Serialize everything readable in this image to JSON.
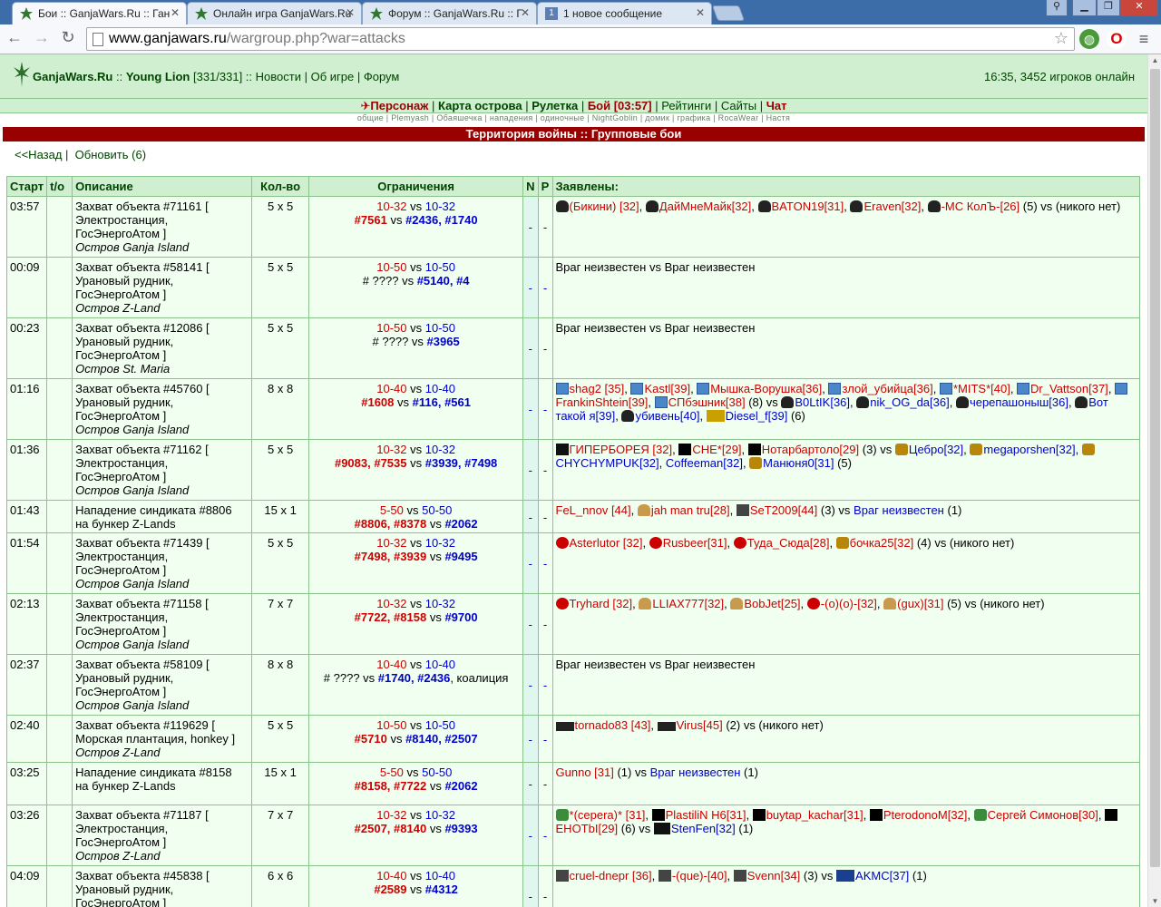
{
  "browser": {
    "tabs": [
      {
        "title": "Бои :: GanjaWars.Ru :: Ган",
        "active": true
      },
      {
        "title": "Онлайн игра GanjaWars.Ru",
        "active": false
      },
      {
        "title": "Форум :: GanjaWars.Ru :: Г",
        "active": false
      },
      {
        "title": "1 новое сообщение",
        "active": false
      }
    ],
    "url_host": "www.ganjawars.ru",
    "url_path": "/wargroup.php?war=attacks"
  },
  "site": {
    "brand": "GanjaWars.Ru",
    "sep1": " :: ",
    "user": "Young Lion",
    "hp": " [331/331] :: ",
    "news": "Новости",
    "about": "Об игре",
    "forum": "Форум",
    "online": "16:35, 3452 игроков онлайн"
  },
  "menu": {
    "person": "Персонаж",
    "map": "Карта острова",
    "roulette": "Рулетка",
    "fight": "Бой [03:57]",
    "ratings": "Рейтинги",
    "sites": "Сайты",
    "chat": "Чат"
  },
  "submenu": "общие | Plemyash | Обаяшечка | нападения | одиночные | NightGoblin | домик | графика | RocaWear | Настя",
  "page_title": "Территория войны :: Групповые бои",
  "nav": {
    "back": "<<Назад",
    "refresh": "Обновить (6)"
  },
  "table": {
    "headers": [
      "Старт",
      "t/o",
      "Описание",
      "Кол-во",
      "Ограничения",
      "N",
      "P",
      "Заявлены:"
    ]
  },
  "rows": [
    {
      "start": "03:57",
      "d1": "Захват объекта #71161 [",
      "d2": "Электростанция,",
      "d3": "ГосЭнергоАтом ]",
      "d4": "Остров Ganja Island",
      "qty": "5 x 5",
      "l1a": "10-32",
      "l1b": "10-32",
      "l2": "#7561",
      "l2b": "#2436, #1740"
    },
    {
      "start": "00:09",
      "d1": "Захват объекта #58141 [",
      "d2": "Урановый рудник,",
      "d3": "ГосЭнергоАтом ]",
      "d4": "Остров Z-Land",
      "qty": "5 x 5",
      "l1a": "10-50",
      "l1b": "10-50",
      "l2": "# ????",
      "l2b": "#5140, #4",
      "plain": "Враг неизвестен vs Враг неизвестен"
    },
    {
      "start": "00:23",
      "d1": "Захват объекта #12086 [",
      "d2": "Урановый рудник,",
      "d3": "ГосЭнергоАтом ]",
      "d4": "Остров St. Maria",
      "qty": "5 x 5",
      "l1a": "10-50",
      "l1b": "10-50",
      "l2": "# ????",
      "l2b": "#3965",
      "plain": "Враг неизвестен vs Враг неизвестен"
    },
    {
      "start": "01:16",
      "d1": "Захват объекта #45760 [",
      "d2": "Урановый рудник,",
      "d3": "ГосЭнергоАтом ]",
      "d4": "Остров Ganja Island",
      "qty": "8 x 8",
      "l1a": "10-40",
      "l1b": "10-40",
      "l2": "#1608",
      "l2b": "#116, #561"
    },
    {
      "start": "01:36",
      "d1": "Захват объекта #71162 [",
      "d2": "Электростанция,",
      "d3": "ГосЭнергоАтом ]",
      "d4": "Остров Ganja Island",
      "qty": "5 x 5",
      "l1a": "10-32",
      "l1b": "10-32",
      "l2": "#9083, #7535",
      "l2b": "#3939, #7498"
    },
    {
      "start": "01:43",
      "d1": "Нападение синдиката #8806",
      "d2": "на бункер Z-Lands",
      "d3": "",
      "d4": "",
      "qty": "15 x 1",
      "l1a": "5-50",
      "l1b": "50-50",
      "l2": "#8806, #8378",
      "l2b": "#2062"
    },
    {
      "start": "01:54",
      "d1": "Захват объекта #71439 [",
      "d2": "Электростанция,",
      "d3": "ГосЭнергоАтом ]",
      "d4": "Остров Ganja Island",
      "qty": "5 x 5",
      "l1a": "10-32",
      "l1b": "10-32",
      "l2": "#7498, #3939",
      "l2b": "#9495"
    },
    {
      "start": "02:13",
      "d1": "Захват объекта #71158 [",
      "d2": "Электростанция,",
      "d3": "ГосЭнергоАтом ]",
      "d4": "Остров Ganja Island",
      "qty": "7 x 7",
      "l1a": "10-32",
      "l1b": "10-32",
      "l2": "#7722, #8158",
      "l2b": "#9700"
    },
    {
      "start": "02:37",
      "d1": "Захват объекта #58109 [",
      "d2": "Урановый рудник,",
      "d3": "ГосЭнергоАтом ]",
      "d4": "Остров Ganja Island",
      "qty": "8 x 8",
      "l1a": "10-40",
      "l1b": "10-40",
      "l2": "# ????",
      "l2b": "#1740, #2436",
      "l2c": ", коалиция",
      "plain": "Враг неизвестен vs Враг неизвестен"
    },
    {
      "start": "02:40",
      "d1": "Захват объекта #119629 [",
      "d2": "Морская плантация, honkey ]",
      "d3": "Остров Z-Land",
      "d4": "",
      "qty": "5 x 5",
      "l1a": "10-50",
      "l1b": "10-50",
      "l2": "#5710",
      "l2b": "#8140, #2507"
    },
    {
      "start": "03:25",
      "d1": "Нападение синдиката #8158",
      "d2": "на бункер Z-Lands",
      "d3": "",
      "d4": "",
      "qty": "15 x 1",
      "l1a": "5-50",
      "l1b": "50-50",
      "l2": "#8158, #7722",
      "l2b": "#2062"
    },
    {
      "start": "03:26",
      "d1": "Захват объекта #71187 [",
      "d2": "Электростанция,",
      "d3": "ГосЭнергоАтом ]",
      "d4": "Остров Z-Land",
      "qty": "7 x 7",
      "l1a": "10-32",
      "l1b": "10-32",
      "l2": "#2507, #8140",
      "l2b": "#9393"
    },
    {
      "start": "04:09",
      "d1": "Захват объекта #45838 [",
      "d2": "Урановый рудник,",
      "d3": "ГосЭнергоАтом ]",
      "d4": "",
      "qty": "6 x 6",
      "l1a": "10-40",
      "l1b": "10-40",
      "l2": "#2589",
      "l2b": "#4312"
    }
  ],
  "np": "-",
  "vs": "vs",
  "declared": {
    "r0": [
      [
        "skull",
        "(Бикини) [32]"
      ],
      [
        "skull",
        "ДайМнеМайк[32]"
      ],
      [
        "skull",
        "BATON19[31]"
      ],
      [
        "skull",
        "Eraven[32]"
      ],
      [
        "skull",
        "-MC КолЪ-[26]"
      ]
    ],
    "r0_tail": "(5) vs (никого нет)",
    "r3a": [
      [
        "cube",
        "shag2 [35]"
      ],
      [
        "cube",
        "Kastl[39]"
      ],
      [
        "cube",
        "Мышка-Ворушка[36]"
      ],
      [
        "cube",
        "злой_убийца[36]"
      ],
      [
        "cube",
        "*MITS*[40]"
      ],
      [
        "cube",
        "Dr_Vattson[37]"
      ],
      [
        "cube",
        "FrankinShtein[39]"
      ],
      [
        "cube",
        "СПбэшник[38]"
      ]
    ],
    "r3a_count": "(8) vs",
    "r3b": [
      [
        "skull",
        "B0LtIK[36]"
      ],
      [
        "skull",
        "nik_OG_da[36]"
      ],
      [
        "skull",
        "черепашоныш[36]"
      ],
      [
        "skull",
        "Вот такой я[39]"
      ],
      [
        "skull",
        "убивень[40]"
      ],
      [
        "mk",
        "Diesel_f[39]"
      ]
    ],
    "r3b_count": "(6)",
    "r4a": [
      [
        "badge",
        "ГИПЕРБОРЕЯ [32]"
      ],
      [
        "dark",
        "СНЕ*[29]"
      ],
      [
        "dark",
        "Нотарбартоло[29]"
      ]
    ],
    "r4a_count": "(3) vs",
    "r4b": [
      [
        "gold",
        "Цебро[32]"
      ],
      [
        "gold",
        "megaporshen[32]"
      ],
      [
        "gold",
        "CHYCHYMPUK[32]"
      ],
      [
        "none",
        "Coffeeman[32]"
      ],
      [
        "gold",
        "Манюня0[31]"
      ]
    ],
    "r4b_count": "(5)",
    "r5a": [
      [
        "none",
        "FeL_nnov [44]"
      ],
      [
        "hat",
        "jah man tru[28]"
      ],
      [
        "w",
        "SeT2009[44]"
      ]
    ],
    "r5a_count": "(3) vs",
    "r5b": "Враг неизвестен",
    "r5b_count": "(1)",
    "r6": [
      [
        "ban",
        "Asterlutor [32]"
      ],
      [
        "ban",
        "Rusbeer[31]"
      ],
      [
        "ban",
        "Туда_Сюда[28]"
      ],
      [
        "gold",
        "бочка25[32]"
      ]
    ],
    "r6_tail": "(4) vs (никого нет)",
    "r7": [
      [
        "ban",
        "Tryhard [32]"
      ],
      [
        "hat",
        "LLIAX777[32]"
      ],
      [
        "hat",
        "BobJet[25]"
      ],
      [
        "ban",
        "-(o)(o)-[32]"
      ],
      [
        "hat",
        "(gux)[31]"
      ]
    ],
    "r7_tail": "(5) vs (никого нет)",
    "r9": [
      [
        "smo",
        "tornado83 [43]"
      ],
      [
        "smo",
        "Virus[45]"
      ]
    ],
    "r9_tail": "(2) vs (никого нет)",
    "r10a": "Gunno [31]",
    "r10a_count": "(1) vs",
    "r10b": "Враг неизвестен",
    "r10b_count": "(1)",
    "r11a": [
      [
        "green",
        "*(cepera)* [31]"
      ],
      [
        "dark",
        "PlastiliN H6[31]"
      ],
      [
        "dark",
        "buytap_kachar[31]"
      ],
      [
        "dark",
        "PterodonoM[32]"
      ],
      [
        "green",
        "Сергей Симонов[30]"
      ],
      [
        "dark",
        "EHOTbI[29]"
      ]
    ],
    "r11a_count": "(6) vs",
    "r11b": [
      [
        "13",
        "StenFen[32]"
      ]
    ],
    "r11b_count": "(1)",
    "r12a": [
      [
        "w",
        "cruel-dnepr [36]"
      ],
      [
        "w",
        "-(que)-[40]"
      ],
      [
        "w",
        "Svenn[34]"
      ]
    ],
    "r12a_count": "(3) vs",
    "r12b": [
      [
        "dh",
        "AKMC[37]"
      ]
    ],
    "r12b_count": "(1)"
  },
  "colors": {
    "red": "#cc0000",
    "blue": "#0000cc",
    "header_bg": "#d0eed0",
    "bar": "#990000",
    "row_bg": "#f0fff0"
  }
}
